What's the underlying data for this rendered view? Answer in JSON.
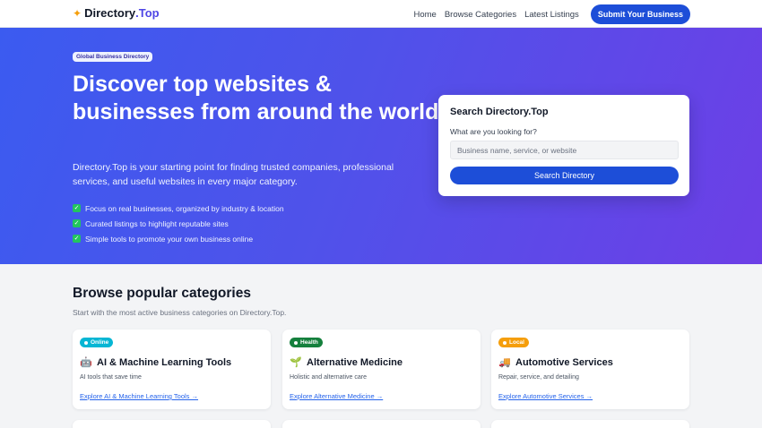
{
  "header": {
    "brand_icon": "sparkle-icon",
    "brand_name": "Directory",
    "brand_tld": ".Top",
    "nav": [
      "Home",
      "Browse Categories",
      "Latest Listings"
    ],
    "submit_label": "Submit Your Business"
  },
  "hero": {
    "badge": "Global Business Directory",
    "title": "Discover top websites & businesses from around the world.",
    "subtitle": "Directory.Top is your starting point for finding trusted companies, professional services, and useful websites in every major category.",
    "features": [
      "Focus on real businesses, organized by industry & location",
      "Curated listings to highlight reputable sites",
      "Simple tools to promote your own business online"
    ]
  },
  "search": {
    "heading": "Search Directory.Top",
    "label": "What are you looking for?",
    "placeholder": "Business name, service, or website",
    "button": "Search Directory"
  },
  "categories": {
    "title": "Browse popular categories",
    "subtitle": "Start with the most active business categories on Directory.Top.",
    "items": [
      {
        "tag": "Online",
        "tag_color": "#06b6d4",
        "icon": "robot-icon",
        "name": "AI & Machine Learning Tools",
        "desc": "AI tools that save time",
        "link": "Explore AI & Machine Learning Tools →"
      },
      {
        "tag": "Health",
        "tag_color": "#15803d",
        "icon": "seedling-icon",
        "name": "Alternative Medicine",
        "desc": "Holistic and alternative care",
        "link": "Explore Alternative Medicine →"
      },
      {
        "tag": "Local",
        "tag_color": "#f59e0b",
        "icon": "truck-icon",
        "name": "Automotive Services",
        "desc": "Repair, service, and detailing",
        "link": "Explore Automotive Services →"
      }
    ]
  },
  "colors": {
    "accent": "#1d4ed8",
    "brand_accent": "#4f46e5",
    "hero_start": "#3b5bf0",
    "hero_end": "#6d3fe6",
    "check": "#22c55e"
  }
}
